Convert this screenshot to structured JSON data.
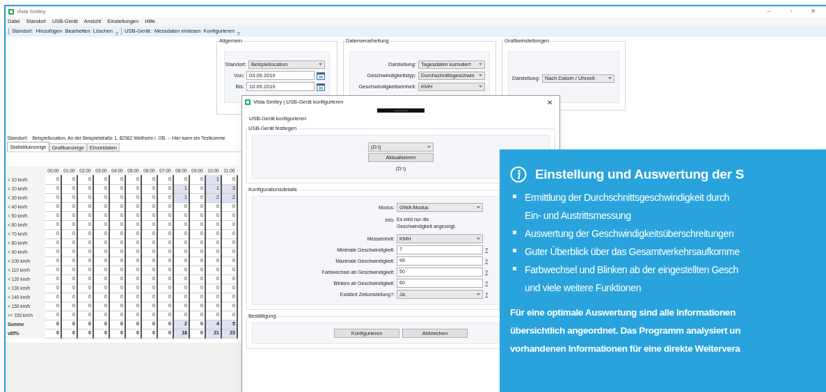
{
  "window": {
    "title": "Vista Smiley",
    "controls": [
      "–",
      "▫",
      "✕"
    ]
  },
  "menu": [
    "Datei",
    "Standort",
    "USB-Gerät",
    "Ansicht",
    "Einstellungen",
    "Hilfe"
  ],
  "toolbar": [
    {
      "label": "Standort:",
      "actions": [
        "Hinzufügen",
        "Bearbeiten",
        "Löschen"
      ]
    },
    {
      "label": "USB-Gerät:",
      "actions": [
        "Messdaten einlesen",
        "Konfigurieren"
      ]
    }
  ],
  "groups": [
    {
      "title": "Allgemein",
      "fields": [
        {
          "kind": "select",
          "label": "Standort:",
          "value": "Beispiellocation"
        },
        {
          "kind": "date",
          "label": "Von:",
          "value": "03.09.2019"
        },
        {
          "kind": "date",
          "label": "Bis:",
          "value": "10.09.2019"
        }
      ]
    },
    {
      "title": "Datenverarbeitung",
      "fields": [
        {
          "kind": "select",
          "label": "Darstellung:",
          "value": "Tagesdaten kumuliert"
        },
        {
          "kind": "select",
          "label": "Geschwindigkeitstyp:",
          "value": "Durchschnittsgeschwin"
        },
        {
          "kind": "select",
          "label": "Geschwindigkeitseinheit:",
          "value": "KMH"
        }
      ]
    },
    {
      "title": "Grafikeinstellungen",
      "fields": [
        {
          "kind": "select",
          "label": "Darstellung:",
          "value": "Nach Datum / Uhrzeit"
        }
      ]
    }
  ],
  "location_line": {
    "label": "Standort:",
    "text": "Beispiellocation, An der Beispielstraße 1, 82362 Weilheim i. OB. -- Hier kann ein Testkomme"
  },
  "tabs": [
    {
      "label": "Statistikanzeige",
      "selected": true
    },
    {
      "label": "Grafikanzeige",
      "selected": false
    },
    {
      "label": "Einzeldaten",
      "selected": false
    }
  ],
  "table": {
    "columns": [
      "00:00",
      "01:00",
      "02:00",
      "03:00",
      "04:00",
      "05:00",
      "06:00",
      "07:00",
      "08:00",
      "09:00",
      "10:00",
      "11:00"
    ],
    "rows": [
      {
        "kind": "speed",
        "label": "< 10 km/h",
        "values": [
          "0",
          "0",
          "0",
          "0",
          "0",
          "0",
          "0",
          "0",
          "0",
          "0",
          "1",
          "0"
        ],
        "highlighted": [
          false,
          false,
          false,
          false,
          false,
          false,
          false,
          false,
          false,
          false,
          true,
          false
        ]
      },
      {
        "kind": "speed",
        "label": "< 20 km/h",
        "values": [
          "0",
          "0",
          "0",
          "0",
          "0",
          "0",
          "0",
          "0",
          "1",
          "0",
          "1",
          "3"
        ],
        "highlighted": [
          false,
          false,
          false,
          false,
          false,
          false,
          false,
          false,
          true,
          false,
          true,
          true
        ]
      },
      {
        "kind": "speed",
        "label": "< 30 km/h",
        "values": [
          "0",
          "0",
          "0",
          "0",
          "0",
          "0",
          "0",
          "0",
          "1",
          "0",
          "2",
          "2"
        ],
        "highlighted": [
          false,
          false,
          false,
          false,
          false,
          false,
          false,
          false,
          true,
          false,
          true,
          true
        ]
      },
      {
        "kind": "speed",
        "label": "< 40 km/h",
        "values": [
          "0",
          "0",
          "0",
          "0",
          "0",
          "0",
          "0",
          "0",
          "0",
          "0",
          "0",
          "0"
        ],
        "highlighted": [
          false,
          false,
          false,
          false,
          false,
          false,
          false,
          false,
          false,
          false,
          false,
          false
        ]
      },
      {
        "kind": "speed",
        "label": "< 50 km/h",
        "values": [
          "0",
          "0",
          "0",
          "0",
          "0",
          "0",
          "0",
          "0",
          "0",
          "0",
          "0",
          "0"
        ],
        "highlighted": [
          false,
          false,
          false,
          false,
          false,
          false,
          false,
          false,
          false,
          false,
          false,
          false
        ]
      },
      {
        "kind": "speed",
        "label": "< 60 km/h",
        "values": [
          "0",
          "0",
          "0",
          "0",
          "0",
          "0",
          "0",
          "0",
          "0",
          "0",
          "0",
          "0"
        ],
        "highlighted": [
          false,
          false,
          false,
          false,
          false,
          false,
          false,
          false,
          false,
          false,
          false,
          false
        ]
      },
      {
        "kind": "speed",
        "label": "< 70 km/h",
        "values": [
          "0",
          "0",
          "0",
          "0",
          "0",
          "0",
          "0",
          "0",
          "0",
          "0",
          "0",
          "0"
        ],
        "highlighted": [
          false,
          false,
          false,
          false,
          false,
          false,
          false,
          false,
          false,
          false,
          false,
          false
        ]
      },
      {
        "kind": "speed",
        "label": "< 80 km/h",
        "values": [
          "0",
          "0",
          "0",
          "0",
          "0",
          "0",
          "0",
          "0",
          "0",
          "0",
          "0",
          "0"
        ],
        "highlighted": [
          false,
          false,
          false,
          false,
          false,
          false,
          false,
          false,
          false,
          false,
          false,
          false
        ]
      },
      {
        "kind": "speed",
        "label": "< 90 km/h",
        "values": [
          "0",
          "0",
          "0",
          "0",
          "0",
          "0",
          "0",
          "0",
          "0",
          "0",
          "0",
          "0"
        ],
        "highlighted": [
          false,
          false,
          false,
          false,
          false,
          false,
          false,
          false,
          false,
          false,
          false,
          false
        ]
      },
      {
        "kind": "speed",
        "label": "< 100 km/h",
        "values": [
          "0",
          "0",
          "0",
          "0",
          "0",
          "0",
          "0",
          "0",
          "0",
          "0",
          "0",
          "0"
        ],
        "highlighted": [
          false,
          false,
          false,
          false,
          false,
          false,
          false,
          false,
          false,
          false,
          false,
          false
        ]
      },
      {
        "kind": "speed",
        "label": "< 110 km/h",
        "values": [
          "0",
          "0",
          "0",
          "0",
          "0",
          "0",
          "0",
          "0",
          "0",
          "0",
          "0",
          "0"
        ],
        "highlighted": [
          false,
          false,
          false,
          false,
          false,
          false,
          false,
          false,
          false,
          false,
          false,
          false
        ]
      },
      {
        "kind": "speed",
        "label": "< 120 km/h",
        "values": [
          "0",
          "0",
          "0",
          "0",
          "0",
          "0",
          "0",
          "0",
          "0",
          "0",
          "0",
          "0"
        ],
        "highlighted": [
          false,
          false,
          false,
          false,
          false,
          false,
          false,
          false,
          false,
          false,
          false,
          false
        ]
      },
      {
        "kind": "speed",
        "label": "< 130 km/h",
        "values": [
          "0",
          "0",
          "0",
          "0",
          "0",
          "0",
          "0",
          "0",
          "0",
          "0",
          "0",
          "0"
        ],
        "highlighted": [
          false,
          false,
          false,
          false,
          false,
          false,
          false,
          false,
          false,
          false,
          false,
          false
        ]
      },
      {
        "kind": "speed",
        "label": "< 140 km/h",
        "values": [
          "0",
          "0",
          "0",
          "0",
          "0",
          "0",
          "0",
          "0",
          "0",
          "0",
          "0",
          "0"
        ],
        "highlighted": [
          false,
          false,
          false,
          false,
          false,
          false,
          false,
          false,
          false,
          false,
          false,
          false
        ]
      },
      {
        "kind": "speed",
        "label": "< 150 km/h",
        "values": [
          "0",
          "0",
          "0",
          "0",
          "0",
          "0",
          "0",
          "0",
          "0",
          "0",
          "0",
          "0"
        ],
        "highlighted": [
          false,
          false,
          false,
          false,
          false,
          false,
          false,
          false,
          false,
          false,
          false,
          false
        ]
      },
      {
        "kind": "speed",
        "label": ">= 150 km/h",
        "values": [
          "0",
          "0",
          "0",
          "0",
          "0",
          "0",
          "0",
          "0",
          "0",
          "0",
          "0",
          "0"
        ],
        "highlighted": [
          false,
          false,
          false,
          false,
          false,
          false,
          false,
          false,
          false,
          false,
          false,
          false
        ]
      },
      {
        "kind": "total",
        "label": "Summe",
        "values": [
          "0",
          "0",
          "0",
          "0",
          "0",
          "0",
          "0",
          "0",
          "2",
          "0",
          "4",
          "5"
        ],
        "highlighted": [
          false,
          false,
          false,
          false,
          false,
          false,
          false,
          false,
          true,
          false,
          true,
          true
        ]
      },
      {
        "kind": "total",
        "label": "v85%",
        "values": [
          "0",
          "0",
          "0",
          "0",
          "0",
          "0",
          "0",
          "0",
          "18",
          "0",
          "21",
          "23"
        ],
        "highlighted": [
          false,
          false,
          false,
          false,
          false,
          false,
          false,
          false,
          true,
          false,
          true,
          true
        ]
      }
    ]
  },
  "dialog": {
    "title": "Vista Smiley | USB-Gerät konfigurieren",
    "close": "✕",
    "heading": "USB-Gerät konfigurieren",
    "device_group": {
      "title": "USB-Gerät festlegen",
      "drive": "(D:\\)",
      "refresh_button": "Aktualisieren",
      "selected_drive": "(D:\\)"
    },
    "config_group": {
      "title": "Konfigurationsdetails",
      "fields": [
        {
          "kind": "select",
          "label": "Modus:",
          "value": "GWA Modus"
        },
        {
          "kind": "info",
          "label": "Info:",
          "value": "Es wird nur die Geschwindigkeit angezeigt."
        },
        {
          "kind": "select",
          "label": "Messeinheit:",
          "value": "KMH"
        },
        {
          "kind": "text",
          "label": "Minimale Geschwindigkeit:",
          "value": "7",
          "help": "?"
        },
        {
          "kind": "text",
          "label": "Maximale Geschwindigkeit:",
          "value": "99",
          "help": "?"
        },
        {
          "kind": "text",
          "label": "Farbwechsel ab Geschwindigkeit:",
          "value": "50",
          "help": "?"
        },
        {
          "kind": "text",
          "label": "Blinken ab Geschwindigkeit:",
          "value": "60",
          "help": "?"
        },
        {
          "kind": "select",
          "label": "Existiert Zeitumstellung?:",
          "value": "Ja",
          "help": "?"
        }
      ]
    },
    "confirm_group": {
      "title": "Bestätigung",
      "buttons": [
        "Konfigurieren",
        "Abbrechen"
      ]
    }
  },
  "info_panel": {
    "title": "Einstellung und Auswertung der S",
    "bullets": [
      {
        "lines": [
          "Ermittlung der Durchschnittsgeschwindigkeit durch",
          "Ein- und Austrittsmessung"
        ]
      },
      {
        "lines": [
          "Auswertung der Geschwindigkeitsüberschreitungen"
        ]
      },
      {
        "lines": [
          "Guter Überblick über das Gesamtverkehrsaufkomme"
        ]
      },
      {
        "lines": [
          "Farbwechsel und Blinken ab der eingestellten Gesch",
          "und viele weitere Funktionen"
        ]
      }
    ],
    "paragraph_lines": [
      "Für eine optimale Auswertung sind alle Informationen",
      "übersichtlich angeordnet. Das Programm analysiert un",
      "vorhandenen Informationen für eine direkte Weitervera"
    ]
  }
}
